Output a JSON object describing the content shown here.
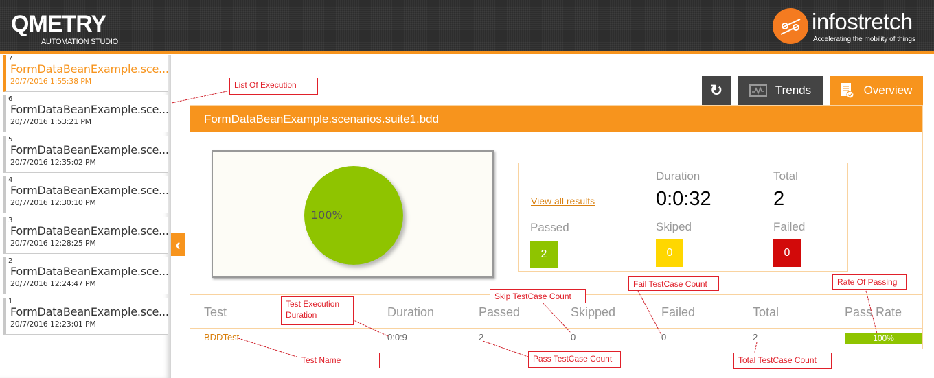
{
  "header": {
    "left_logo": "QMETRY",
    "left_logo_sub": "AUTOMATION STUDIO",
    "right_logo": "infostretch",
    "right_tagline": "Accelerating the mobility of things"
  },
  "sidebar": {
    "items": [
      {
        "num": "7",
        "title": "FormDataBeanExample.sce...",
        "time": "20/7/2016 1:55:38 PM",
        "active": true
      },
      {
        "num": "6",
        "title": "FormDataBeanExample.sce...",
        "time": "20/7/2016 1:53:21 PM"
      },
      {
        "num": "5",
        "title": "FormDataBeanExample.sce...",
        "time": "20/7/2016 12:35:02 PM"
      },
      {
        "num": "4",
        "title": "FormDataBeanExample.sce...",
        "time": "20/7/2016 12:30:10 PM"
      },
      {
        "num": "3",
        "title": "FormDataBeanExample.sce...",
        "time": "20/7/2016 12:28:25 PM"
      },
      {
        "num": "2",
        "title": "FormDataBeanExample.sce...",
        "time": "20/7/2016 12:24:47 PM"
      },
      {
        "num": "1",
        "title": "FormDataBeanExample.sce...",
        "time": "20/7/2016 12:23:01 PM"
      }
    ],
    "collapse_icon": "‹"
  },
  "tabs": {
    "refresh_icon": "↻",
    "trends": "Trends",
    "overview": "Overview"
  },
  "panel": {
    "title": "FormDataBeanExample.scenarios.suite1.bdd"
  },
  "chart_data": {
    "type": "pie",
    "slices": [
      {
        "label": "Passed",
        "value": 100,
        "color": "#8fc400"
      }
    ],
    "data_label": "100%"
  },
  "stats": {
    "view_all": "View all results",
    "duration_label": "Duration",
    "duration": "0:0:32",
    "total_label": "Total",
    "total": "2",
    "passed_label": "Passed",
    "passed": "2",
    "skipped_label": "Skiped",
    "skipped": "0",
    "failed_label": "Failed",
    "failed": "0",
    "colors": {
      "passed": "#8fc400",
      "skipped": "#ffd700",
      "failed": "#d20a0a"
    }
  },
  "table": {
    "headers": [
      "Test",
      "Duration",
      "Passed",
      "Skipped",
      "Failed",
      "Total",
      "Pass Rate"
    ],
    "rows": [
      {
        "test": "BDDTest",
        "duration": "0:0:9",
        "passed": "2",
        "skipped": "0",
        "failed": "0",
        "total": "2",
        "pass_rate": "100%",
        "pass_rate_value": 100
      }
    ]
  },
  "annotations": {
    "list": "List Of Execution",
    "duration": "Test Execution Duration",
    "name": "Test Name",
    "skip": "Skip TestCase Count",
    "pass": "Pass TestCase Count",
    "fail": "Fail TestCase Count",
    "total": "Total TestCase Count",
    "rate": "Rate Of Passing"
  }
}
